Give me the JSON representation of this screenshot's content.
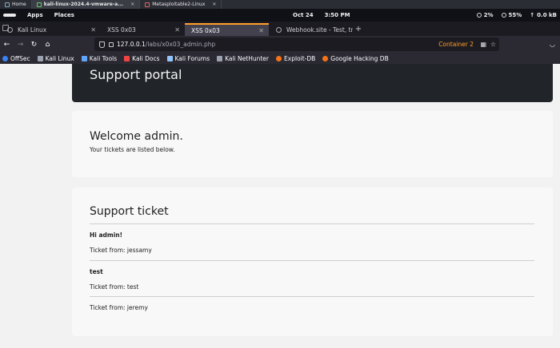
{
  "vm_tabs": [
    {
      "label": "Home",
      "active": false
    },
    {
      "label": "kali-linux-2024.4-vmware-a...",
      "active": true
    },
    {
      "label": "Metasploitable2-Linux",
      "active": false
    }
  ],
  "system_bar": {
    "apps": "Apps",
    "places": "Places",
    "date": "Oct 24",
    "time": "3:50 PM",
    "cpu": "2%",
    "memory": "55%",
    "network": "0.0 kB"
  },
  "browser_tabs": [
    {
      "label": "Kali Linux",
      "active": false
    },
    {
      "label": "XSS 0x03",
      "active": false
    },
    {
      "label": "XSS 0x03",
      "active": true
    },
    {
      "label": "Webhook.site - Test, tra",
      "active": false
    }
  ],
  "address_bar": {
    "url_host": "127.0.0.1",
    "url_path": "/labs/x0x03_admin.php",
    "container": "Container 2"
  },
  "bookmarks": [
    {
      "label": "OffSec",
      "color": "#3b82f6"
    },
    {
      "label": "Kali Linux",
      "color": "#9ca3af"
    },
    {
      "label": "Kali Tools",
      "color": "#60a5fa"
    },
    {
      "label": "Kali Docs",
      "color": "#ef4444"
    },
    {
      "label": "Kali Forums",
      "color": "#93c5fd"
    },
    {
      "label": "Kali NetHunter",
      "color": "#9ca3af"
    },
    {
      "label": "Exploit-DB",
      "color": "#f97316"
    },
    {
      "label": "Google Hacking DB",
      "color": "#f97316"
    }
  ],
  "page": {
    "header_title": "Support portal",
    "welcome_title": "Welcome admin.",
    "welcome_text": "Your tickets are listed below.",
    "tickets_title": "Support ticket",
    "tickets": [
      {
        "title": "Hi admin!",
        "from": "Ticket from: jessamy"
      },
      {
        "title": "test",
        "from": "Ticket from: test"
      },
      {
        "title": "",
        "from": "Ticket from: jeremy"
      }
    ]
  }
}
